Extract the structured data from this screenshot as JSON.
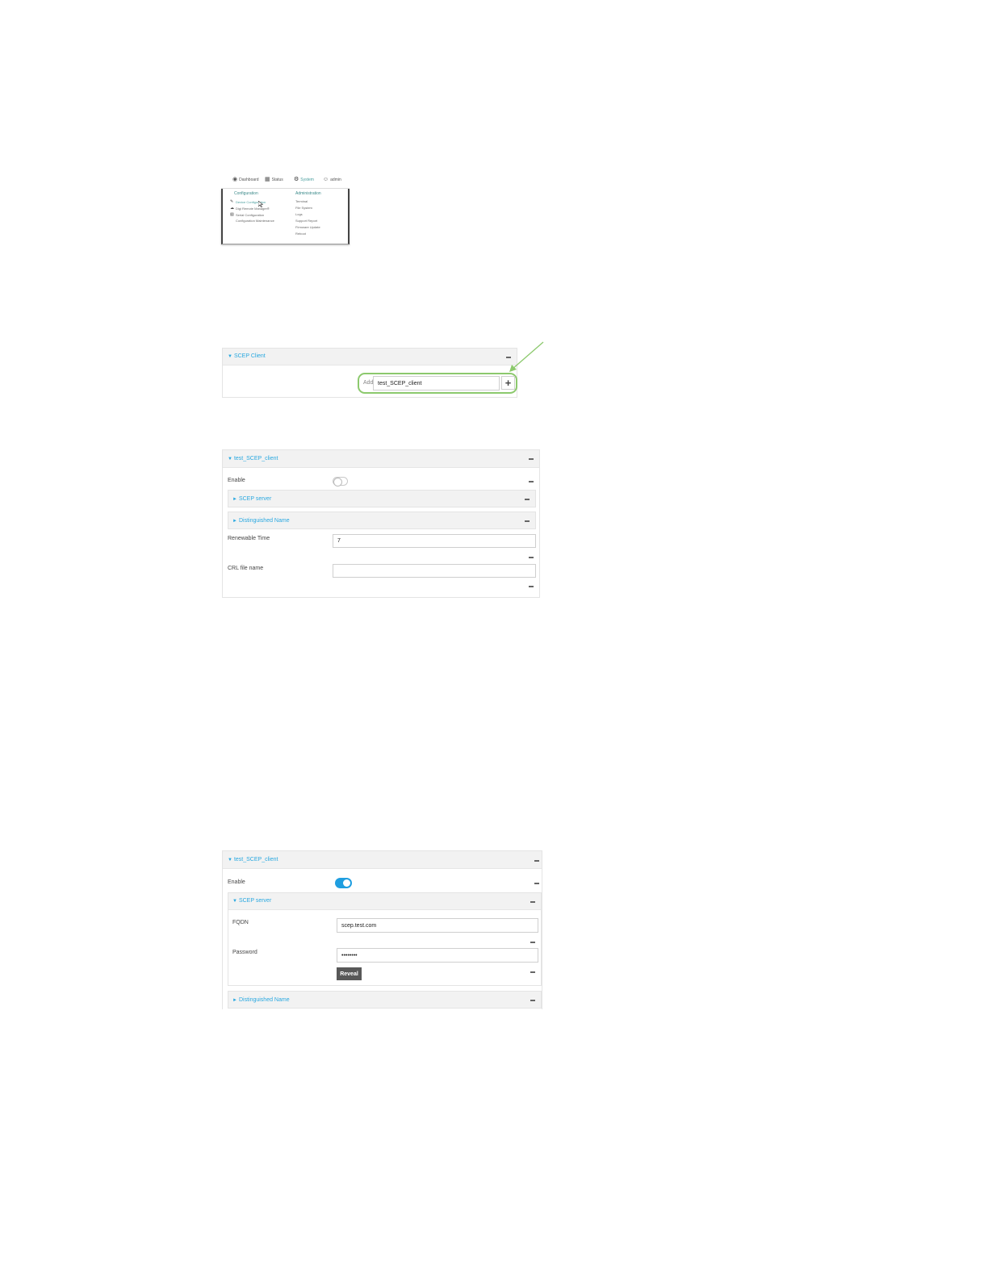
{
  "menu": {
    "topbar": {
      "dashboard": "Dashboard",
      "status": "Status",
      "system": "System",
      "admin": "admin"
    },
    "configuration": {
      "heading": "Configuration",
      "items": [
        "Device Configuration",
        "Digi Remote Manager®",
        "Serial Configuration",
        "Configuration Maintenance"
      ]
    },
    "administration": {
      "heading": "Administration",
      "items": [
        "Terminal",
        "File System",
        "Logs",
        "Support Report",
        "Firmware Update",
        "Reboot"
      ]
    }
  },
  "add_panel": {
    "title": "SCEP Client",
    "add_label": "Add",
    "input_value": "test_SCEP_client",
    "plus_symbol": "+",
    "highlight_color": "#8cc96d"
  },
  "client_panel_collapsed": {
    "title": "test_SCEP_client",
    "enable_label": "Enable",
    "enable_state": false,
    "scep_server_title": "SCEP server",
    "dn_title": "Distinguished Name",
    "renewable_label": "Renewable Time",
    "renewable_value": "7",
    "crl_label": "CRL file name",
    "crl_value": ""
  },
  "client_panel_expanded": {
    "title": "test_SCEP_client",
    "enable_label": "Enable",
    "enable_state": true,
    "scep_server_title": "SCEP server",
    "fqdn_label": "FQDN",
    "fqdn_value": "scep.test.com",
    "password_label": "Password",
    "password_value": "••••••••",
    "reveal_label": "Reveal",
    "dn_title": "Distinguished Name"
  },
  "colors": {
    "title_blue": "#29a8e0",
    "toggle_on": "#1f9ee0",
    "menu_teal": "#3b8a8a"
  },
  "icons": {
    "collapse": "dash-icon",
    "expanded": "caret-down-icon",
    "collapsed": "caret-right-icon"
  }
}
